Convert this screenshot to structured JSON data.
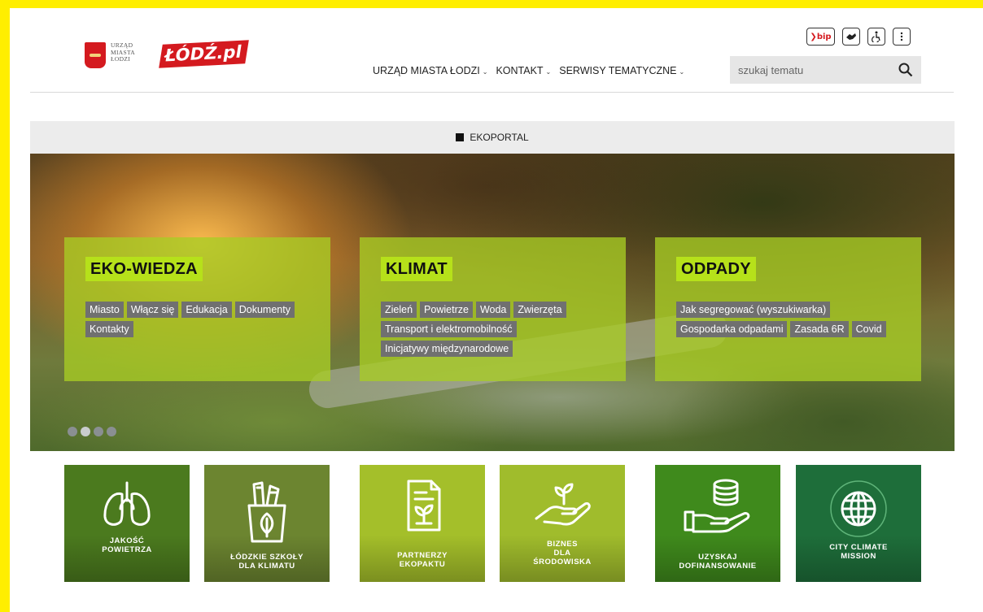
{
  "header": {
    "um_logo_lines": [
      "URZĄD",
      "MIASTA",
      "ŁODZI"
    ],
    "lodz_logo": "ŁÓDŹ.pl",
    "nav": [
      {
        "label": "URZĄD MIASTA ŁODZI"
      },
      {
        "label": "KONTAKT"
      },
      {
        "label": "SERWISY TEMATYCZNE"
      }
    ],
    "search_placeholder": "szukaj tematu",
    "util": {
      "bip_label": "bip",
      "icons": [
        "bip-icon",
        "sign-language-icon",
        "accessibility-icon",
        "more-vertical-icon"
      ]
    }
  },
  "breadcrumb": {
    "label": "EKOPORTAL"
  },
  "hero": {
    "cards": [
      {
        "title": "EKO-WIEDZA",
        "tags": [
          "Miasto",
          "Włącz się",
          "Edukacja",
          "Dokumenty",
          "Kontakty"
        ]
      },
      {
        "title": "KLIMAT",
        "tags": [
          "Zieleń",
          "Powietrze",
          "Woda",
          "Zwierzęta",
          "Transport i elektromobilność",
          "Inicjatywy międzynarodowe"
        ]
      },
      {
        "title": "ODPADY",
        "tags": [
          "Jak segregować (wyszukiwarka)",
          "Gospodarka odpadami",
          "Zasada 6R",
          "Covid"
        ]
      }
    ],
    "slider_count": 4,
    "active_slide": 2
  },
  "tiles": [
    {
      "lines": [
        "JAKOŚĆ",
        "POWIETRZA"
      ],
      "icon": "lungs-icon",
      "color": "#4b7a1e"
    },
    {
      "lines": [
        "ŁÓDZKIE SZKOŁY",
        "DLA KLIMATU"
      ],
      "icon": "school-supplies-icon",
      "color": "#6c8530"
    },
    {
      "lines": [
        "PARTNERZY",
        "EKOPAKTU"
      ],
      "icon": "document-plant-icon",
      "color": "#a4bf2a"
    },
    {
      "lines": [
        "BIZNES",
        "DLA",
        "ŚRODOWISKA"
      ],
      "icon": "hand-plant-icon",
      "color": "#a0bc2c"
    },
    {
      "lines": [
        "UZYSKAJ",
        "DOFINANSOWANIE"
      ],
      "icon": "hand-coins-icon",
      "color": "#3f8a1c"
    },
    {
      "lines": [
        "CITY CLIMATE",
        "MISSION"
      ],
      "icon": "globe-icon",
      "color": "#1e6e3a"
    }
  ]
}
